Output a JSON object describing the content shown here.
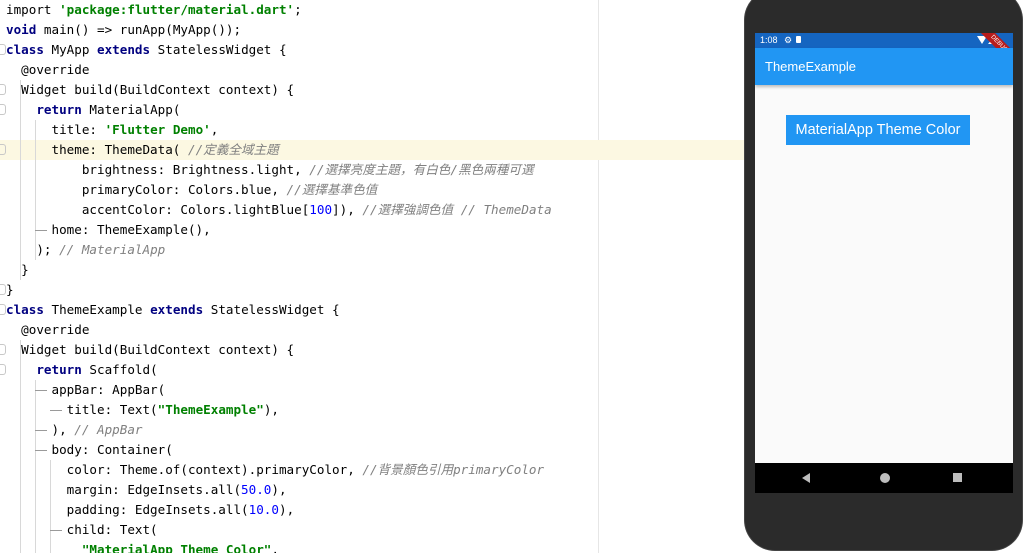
{
  "editor": {
    "lines": [
      {
        "segments": [
          [
            "",
            "import "
          ],
          [
            "str",
            "'package:flutter/material.dart'"
          ],
          [
            "",
            ";"
          ]
        ]
      },
      {
        "segments": [
          [
            "kw",
            "void"
          ],
          [
            "",
            " main() => runApp(MyApp());"
          ]
        ]
      },
      {
        "segments": [
          [
            "kw",
            "class"
          ],
          [
            "",
            " MyApp "
          ],
          [
            "kw",
            "extends"
          ],
          [
            "",
            " StatelessWidget {"
          ]
        ]
      },
      {
        "segments": [
          [
            "",
            "  @override"
          ]
        ]
      },
      {
        "segments": [
          [
            "",
            "  Widget build(BuildContext context) {"
          ]
        ]
      },
      {
        "segments": [
          [
            "",
            "    "
          ],
          [
            "kw",
            "return"
          ],
          [
            "",
            " MaterialApp("
          ]
        ]
      },
      {
        "segments": [
          [
            "",
            "      title: "
          ],
          [
            "str",
            "'Flutter Demo'"
          ],
          [
            "",
            ","
          ]
        ]
      },
      {
        "segments": [
          [
            "",
            "      theme: ThemeData( "
          ],
          [
            "cmt",
            "//定義全域主題"
          ]
        ]
      },
      {
        "segments": [
          [
            "",
            "          brightness: Brightness.light, "
          ],
          [
            "cmt",
            "//選擇亮度主題，有白色/黑色兩種可選"
          ]
        ]
      },
      {
        "segments": [
          [
            "",
            "          primaryColor: Colors.blue, "
          ],
          [
            "cmt",
            "//選擇基準色值"
          ]
        ]
      },
      {
        "segments": [
          [
            "",
            "          accentColor: Colors.lightBlue["
          ],
          [
            "num",
            "100"
          ],
          [
            "",
            "]), "
          ],
          [
            "cmt",
            "//選擇強調色值 // ThemeData"
          ]
        ]
      },
      {
        "segments": [
          [
            "",
            "      home: ThemeExample(),"
          ]
        ]
      },
      {
        "segments": [
          [
            "",
            "    ); "
          ],
          [
            "cmt",
            "// MaterialApp"
          ]
        ]
      },
      {
        "segments": [
          [
            "",
            "  }"
          ]
        ]
      },
      {
        "segments": [
          [
            "",
            "}"
          ]
        ]
      },
      {
        "segments": [
          [
            "kw",
            "class"
          ],
          [
            "",
            " ThemeExample "
          ],
          [
            "kw",
            "extends"
          ],
          [
            "",
            " StatelessWidget {"
          ]
        ]
      },
      {
        "segments": [
          [
            "",
            "  @override"
          ]
        ]
      },
      {
        "segments": [
          [
            "",
            "  Widget build(BuildContext context) {"
          ]
        ]
      },
      {
        "segments": [
          [
            "",
            "    "
          ],
          [
            "kw",
            "return"
          ],
          [
            "",
            " Scaffold("
          ]
        ]
      },
      {
        "segments": [
          [
            "",
            "      appBar: AppBar("
          ]
        ]
      },
      {
        "segments": [
          [
            "",
            "        title: Text("
          ],
          [
            "str",
            "\"ThemeExample\""
          ],
          [
            "",
            "),"
          ]
        ]
      },
      {
        "segments": [
          [
            "",
            "      ), "
          ],
          [
            "cmt",
            "// AppBar"
          ]
        ]
      },
      {
        "segments": [
          [
            "",
            "      body: Container("
          ]
        ]
      },
      {
        "segments": [
          [
            "",
            "        color: Theme.of(context).primaryColor, "
          ],
          [
            "cmt",
            "//背景顏色引用primaryColor"
          ]
        ]
      },
      {
        "segments": [
          [
            "",
            "        margin: EdgeInsets.all("
          ],
          [
            "num",
            "50.0"
          ],
          [
            "",
            "),"
          ]
        ]
      },
      {
        "segments": [
          [
            "",
            "        padding: EdgeInsets.all("
          ],
          [
            "num",
            "10.0"
          ],
          [
            "",
            "),"
          ]
        ]
      },
      {
        "segments": [
          [
            "",
            "        child: Text("
          ]
        ]
      },
      {
        "segments": [
          [
            "",
            "          "
          ],
          [
            "str",
            "\"MaterialApp Theme Color\""
          ],
          [
            "",
            ","
          ]
        ]
      }
    ],
    "highlighted_line": 7
  },
  "phone": {
    "status_time": "1:08",
    "debug_label": "DEBUG",
    "app_title": "ThemeExample",
    "body_text": "MaterialApp Theme Color",
    "colors": {
      "primary": "#2196f3",
      "status_bar": "#1565c0",
      "background": "#fafafa"
    }
  }
}
